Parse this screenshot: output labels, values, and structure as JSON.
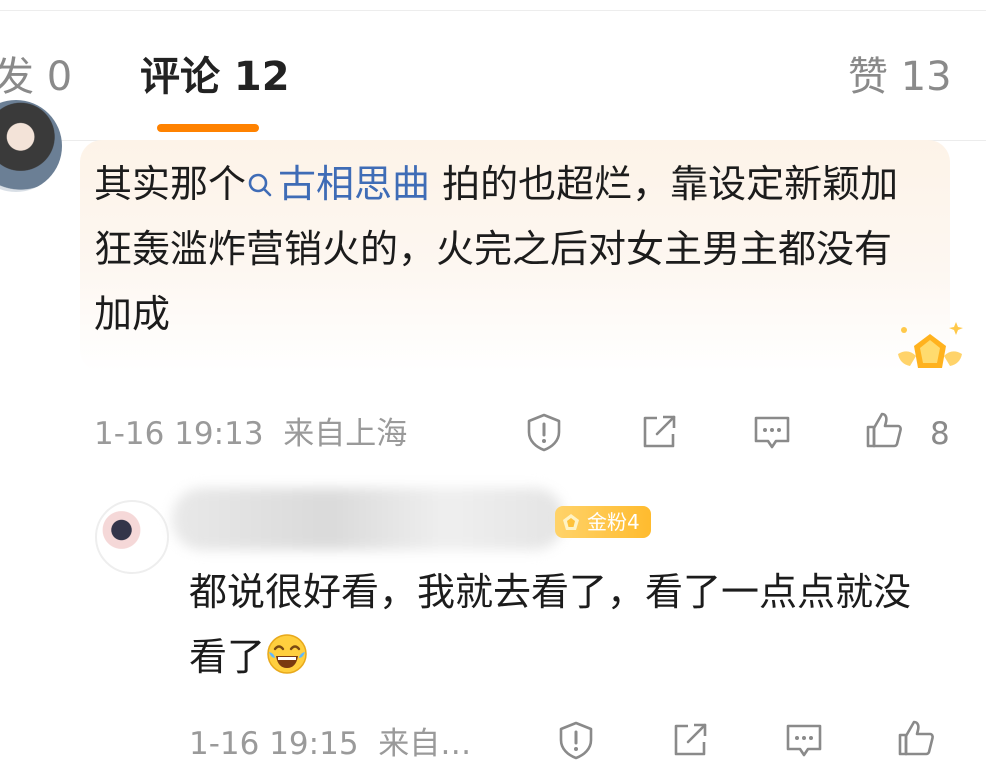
{
  "tabs": {
    "repost_label": "发 0",
    "comment_label": "评论 12",
    "like_label": "赞 13"
  },
  "comment1": {
    "text_before": "其实那个",
    "topic": "古相思曲",
    "text_after": " 拍的也超烂，靠设定新颖加狂轰滥炸营销火的，火完之后对女主男主都没有加成",
    "time": "1-16 19:13",
    "location": "来自上海",
    "like_count": "8",
    "icons": [
      "report-icon",
      "share-icon",
      "reply-icon",
      "like-icon"
    ]
  },
  "comment2": {
    "fan_badge": "金粉4",
    "text": "都说很好看，我就去看了，看了一点点就没看了",
    "emoji": "laugh-cry-emoji",
    "time": "1-16 19:15",
    "location": "来自…",
    "icons": [
      "report-icon",
      "share-icon",
      "reply-icon",
      "like-icon"
    ]
  },
  "colors": {
    "accent": "#ff8200",
    "topic_link": "#3f6cb6",
    "fan_badge": "#ffbb2e",
    "meta_text": "#9a9a9a"
  }
}
